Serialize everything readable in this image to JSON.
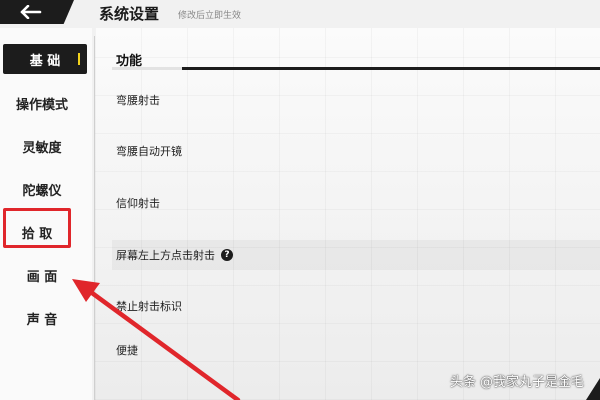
{
  "header": {
    "title": "系统设置",
    "subtitle": "修改后立即生效"
  },
  "sidebar": {
    "items": [
      {
        "label": "基 础",
        "active": true
      },
      {
        "label": "操作模式"
      },
      {
        "label": "灵敏度"
      },
      {
        "label": "陀螺仪"
      },
      {
        "label": "拾 取",
        "highlighted": true
      },
      {
        "label": "画 面"
      },
      {
        "label": "声 音"
      }
    ]
  },
  "main": {
    "section_title": "功能",
    "rows": [
      {
        "label": "弯腰射击"
      },
      {
        "label": "弯腰自动开镜"
      },
      {
        "label": "信仰射击"
      },
      {
        "label": "屏幕左上方点击射击",
        "help_icon": "?"
      },
      {
        "label": "禁止射击标识"
      },
      {
        "label": "便捷"
      }
    ]
  },
  "watermark": "头条 @我家丸子是金毛",
  "colors": {
    "accent_yellow": "#f2d21c",
    "annotation_red": "#e0262b",
    "dark": "#1c1c1c"
  }
}
